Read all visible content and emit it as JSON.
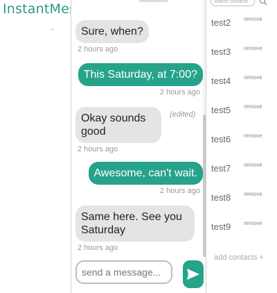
{
  "app": {
    "title": "InstantMessenger"
  },
  "conversation": {
    "messages": [
      {
        "direction": "in",
        "text": "Sure, when?",
        "time": "2 hours ago",
        "edited": ""
      },
      {
        "direction": "out",
        "text": "This Saturday, at 7:00?",
        "time": "2 hours ago",
        "edited": ""
      },
      {
        "direction": "in",
        "text": "Okay sounds good",
        "time": "2 hours ago",
        "edited": "(edited)"
      },
      {
        "direction": "out",
        "text": "Awesome, can't wait.",
        "time": "2 hours ago",
        "edited": ""
      },
      {
        "direction": "in",
        "text": "Same here. See you Saturday",
        "time": "2 hours ago",
        "edited": ""
      }
    ]
  },
  "composer": {
    "placeholder": "send a message...",
    "send_icon": "send-arrow-icon"
  },
  "contacts": {
    "search_placeholder": "search contacts",
    "search_icon": "search-icon",
    "items": [
      {
        "name": "test2",
        "remove_label": "remove"
      },
      {
        "name": "test3",
        "remove_label": "remove"
      },
      {
        "name": "test4",
        "remove_label": "remove"
      },
      {
        "name": "test5",
        "remove_label": "remove"
      },
      {
        "name": "test6",
        "remove_label": "remove"
      },
      {
        "name": "test7",
        "remove_label": "remove"
      },
      {
        "name": "test8",
        "remove_label": "remove"
      },
      {
        "name": "test9",
        "remove_label": "remove"
      }
    ],
    "add_label": "add contacts +"
  },
  "colors": {
    "accent": "#26a38a",
    "title": "#2a9a86",
    "incoming_bubble": "#e4e4e4"
  }
}
